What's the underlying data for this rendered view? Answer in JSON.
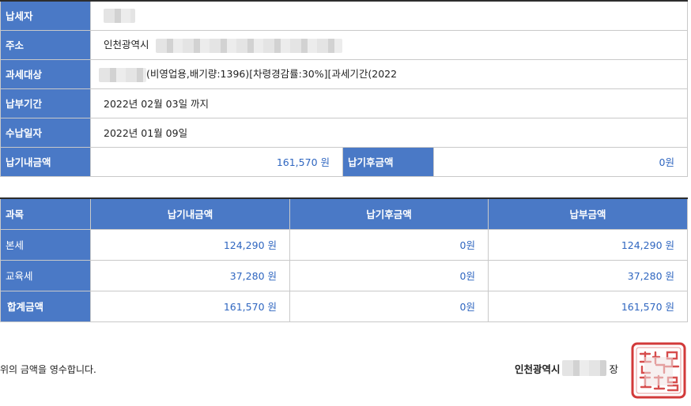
{
  "info": {
    "payer_label": "납세자",
    "address_label": "주소",
    "address_city": "인천광역시",
    "target_label": "과세대상",
    "target_text": "(비영업용,배기량:1396)[차령경감률:30%][과세기간(2022",
    "due_label": "납부기간",
    "due_value": "2022년 02월 03일 까지",
    "receipt_date_label": "수납일자",
    "receipt_date_value": "2022년 01월 09일",
    "before_due_label": "납기내금액",
    "before_due_value": "161,570 원",
    "after_due_label": "납기후금액",
    "after_due_value": "0원"
  },
  "tax": {
    "headers": [
      "과목",
      "납기내금액",
      "납기후금액",
      "납부금액"
    ],
    "rows": [
      {
        "name": "본세",
        "before": "124,290 원",
        "after": "0원",
        "paid": "124,290 원"
      },
      {
        "name": "교육세",
        "before": "37,280 원",
        "after": "0원",
        "paid": "37,280 원"
      },
      {
        "name": "합계금액",
        "before": "161,570 원",
        "after": "0원",
        "paid": "161,570 원"
      }
    ]
  },
  "footer": {
    "receipt_text": "위의 금액을 영수합니다.",
    "signature_prefix": "인천광역시",
    "signature_suffix": "장"
  },
  "colors": {
    "header_blue": "#4a79c6",
    "amount_blue": "#2f66c0",
    "seal_red": "#d23a3a"
  }
}
